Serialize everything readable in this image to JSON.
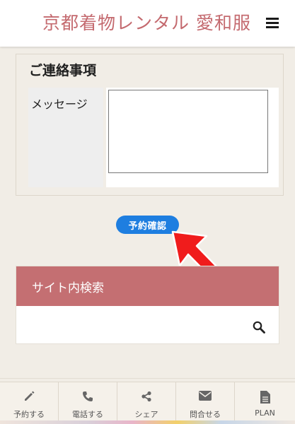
{
  "header": {
    "site_title": "京都着物レンタル 愛和服",
    "menu_icon": "hamburger-menu-icon"
  },
  "contact_section": {
    "heading": "ご連絡事項",
    "message_label": "メッセージ",
    "message_value": ""
  },
  "confirm_button": {
    "label": "予約確認",
    "color": "#1e7ee0"
  },
  "annotation": {
    "arrow_color": "#f01c1c"
  },
  "site_search": {
    "title": "サイト内検索",
    "input_value": "",
    "title_bar_color": "#c46f72",
    "icon": "search-icon"
  },
  "bottom_nav": {
    "items": [
      {
        "label": "予約する",
        "icon": "pencil-icon"
      },
      {
        "label": "電話する",
        "icon": "phone-icon"
      },
      {
        "label": "シェア",
        "icon": "share-icon"
      },
      {
        "label": "問合せる",
        "icon": "envelope-icon"
      },
      {
        "label": "PLAN",
        "icon": "document-icon"
      }
    ]
  },
  "colors": {
    "brand_pink": "#c46a6f",
    "page_background": "#f1ede6"
  }
}
